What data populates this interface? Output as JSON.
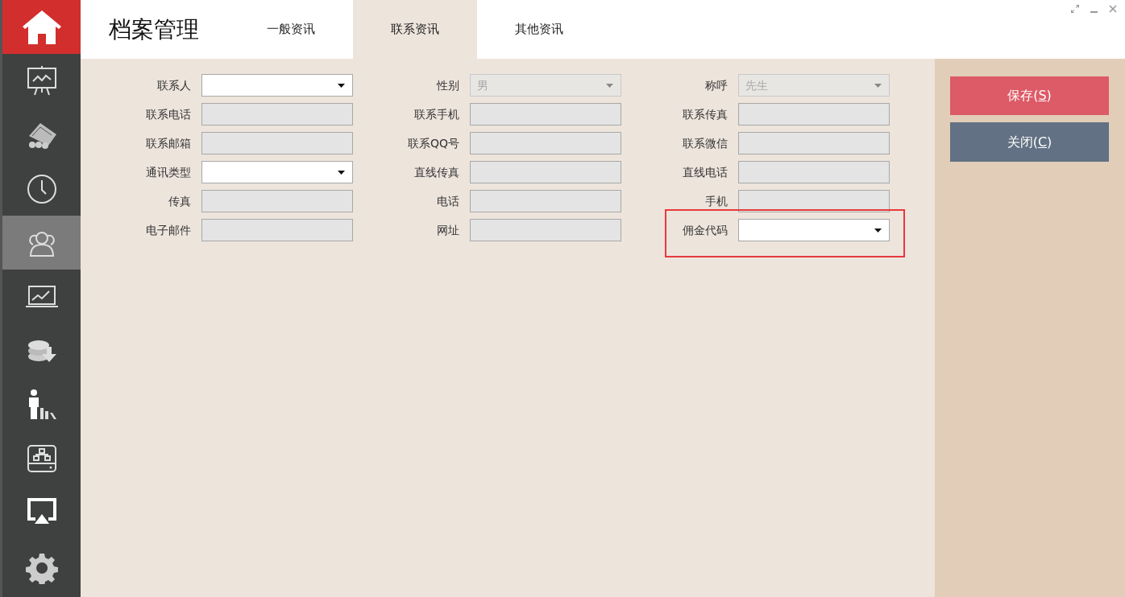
{
  "sidebar": {
    "items": [
      {
        "kind": "home",
        "selected": false
      },
      {
        "kind": "nav",
        "selected": false
      },
      {
        "kind": "nav",
        "selected": false
      },
      {
        "kind": "nav",
        "selected": false
      },
      {
        "kind": "nav",
        "selected": true
      },
      {
        "kind": "nav",
        "selected": false
      },
      {
        "kind": "nav",
        "selected": false
      },
      {
        "kind": "nav",
        "selected": false
      },
      {
        "kind": "nav",
        "selected": false
      },
      {
        "kind": "nav",
        "selected": false
      },
      {
        "kind": "nav",
        "selected": false
      }
    ]
  },
  "title": "档案管理",
  "tabs": [
    {
      "label": "一般资讯",
      "selected": false
    },
    {
      "label": "联系资讯",
      "selected": true
    },
    {
      "label": "其他资讯",
      "selected": false
    }
  ],
  "form": {
    "columns": [
      {
        "fields": [
          {
            "label": "联系人",
            "kind": "select",
            "disabled": false,
            "highlighted": false
          },
          {
            "label": "联系电话",
            "kind": "text",
            "disabled": true,
            "highlighted": false
          },
          {
            "label": "联系邮箱",
            "kind": "text",
            "disabled": true,
            "highlighted": false
          },
          {
            "label": "通讯类型",
            "kind": "select",
            "disabled": false,
            "highlighted": false
          },
          {
            "label": "传真",
            "kind": "text",
            "disabled": true,
            "highlighted": false
          },
          {
            "label": "电子邮件",
            "kind": "text",
            "disabled": true,
            "highlighted": false
          }
        ]
      },
      {
        "fields": [
          {
            "label": "性别",
            "kind": "select",
            "disabled": true,
            "value": "男",
            "highlighted": false
          },
          {
            "label": "联系手机",
            "kind": "text",
            "disabled": true,
            "highlighted": false
          },
          {
            "label": "联系QQ号",
            "kind": "text",
            "disabled": true,
            "highlighted": false
          },
          {
            "label": "直线传真",
            "kind": "text",
            "disabled": true,
            "highlighted": false
          },
          {
            "label": "电话",
            "kind": "text",
            "disabled": true,
            "highlighted": false
          },
          {
            "label": "网址",
            "kind": "text",
            "disabled": true,
            "highlighted": false
          }
        ]
      },
      {
        "fields": [
          {
            "label": "称呼",
            "kind": "select",
            "disabled": true,
            "value": "先生",
            "highlighted": false
          },
          {
            "label": "联系传真",
            "kind": "text",
            "disabled": true,
            "highlighted": false
          },
          {
            "label": "联系微信",
            "kind": "text",
            "disabled": true,
            "highlighted": false
          },
          {
            "label": "直线电话",
            "kind": "text",
            "disabled": true,
            "highlighted": false
          },
          {
            "label": "手机",
            "kind": "text",
            "disabled": true,
            "highlighted": false
          },
          {
            "label": "佣金代码",
            "kind": "select",
            "disabled": false,
            "highlighted": true
          }
        ]
      }
    ]
  },
  "actions": [
    {
      "kind": "save",
      "label_before": "保存(",
      "access_key": "S",
      "label_after": ")"
    },
    {
      "kind": "close",
      "label_before": "关闭(",
      "access_key": "C",
      "label_after": ")"
    }
  ]
}
